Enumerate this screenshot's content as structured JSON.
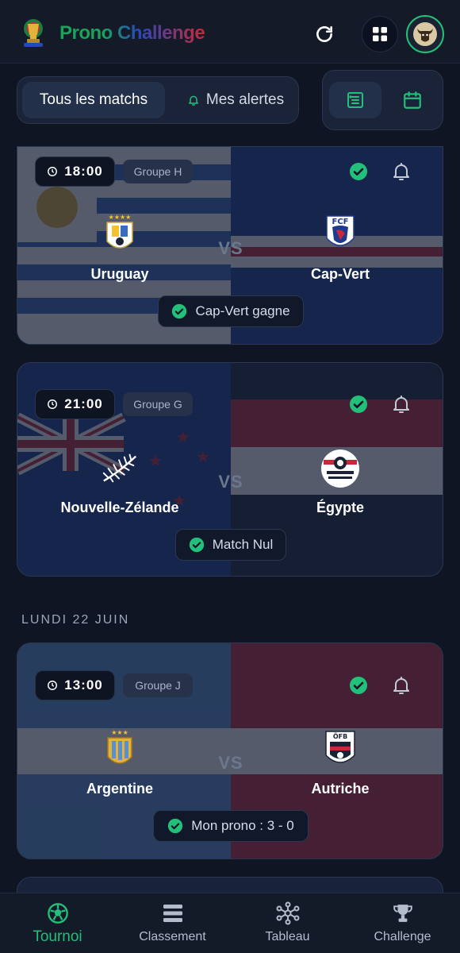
{
  "header": {
    "app_name": "Prono Challenge",
    "logo_icon": "trophy-logo-icon",
    "refresh_icon": "refresh-icon",
    "grid_icon": "grid-icon",
    "avatar_icon": "bull-avatar-icon"
  },
  "filters": {
    "all_matches": "Tous les matchs",
    "my_alerts": "Mes alertes",
    "list_view_icon": "list-view-icon",
    "calendar_view_icon": "calendar-icon"
  },
  "colors": {
    "accent": "#22c07a",
    "background": "#0f1523",
    "card": "#18223a"
  },
  "matches": [
    {
      "time": "18:00",
      "group": "Groupe H",
      "home": "Uruguay",
      "away": "Cap-Vert",
      "vs": "VS",
      "result": "Cap-Vert gagne",
      "predicted": true
    },
    {
      "time": "21:00",
      "group": "Groupe G",
      "home": "Nouvelle-Zélande",
      "away": "Égypte",
      "vs": "VS",
      "result": "Match Nul",
      "predicted": true
    },
    {
      "time": "13:00",
      "group": "Groupe J",
      "home": "Argentine",
      "away": "Autriche",
      "vs": "VS",
      "result": "Mon prono : 3 - 0",
      "predicted": true
    }
  ],
  "date_section": "LUNDI 22 JUIN",
  "nav": [
    {
      "label": "Tournoi",
      "icon": "soccer-ball-icon",
      "active": true
    },
    {
      "label": "Classement",
      "icon": "ranking-icon",
      "active": false
    },
    {
      "label": "Tableau",
      "icon": "bracket-icon",
      "active": false
    },
    {
      "label": "Challenge",
      "icon": "trophy-icon",
      "active": false
    }
  ]
}
